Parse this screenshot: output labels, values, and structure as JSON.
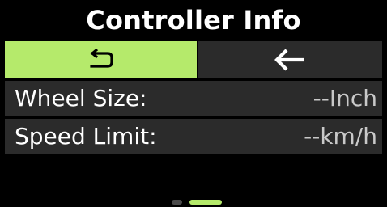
{
  "header": {
    "title": "Controller Info"
  },
  "nav": {
    "back_icon": "return-icon",
    "prev_icon": "arrow-left-icon"
  },
  "rows": [
    {
      "label": "Wheel Size:",
      "value": "--Inch"
    },
    {
      "label": "Speed Limit:",
      "value": "--km/h"
    }
  ],
  "pagination": {
    "total_pages": 2,
    "current_page": 2
  },
  "colors": {
    "accent": "#b5ea6b",
    "row_background": "#2b2b2b",
    "background": "#000000",
    "text": "#ffffff",
    "value_text": "#c9c9c9"
  }
}
